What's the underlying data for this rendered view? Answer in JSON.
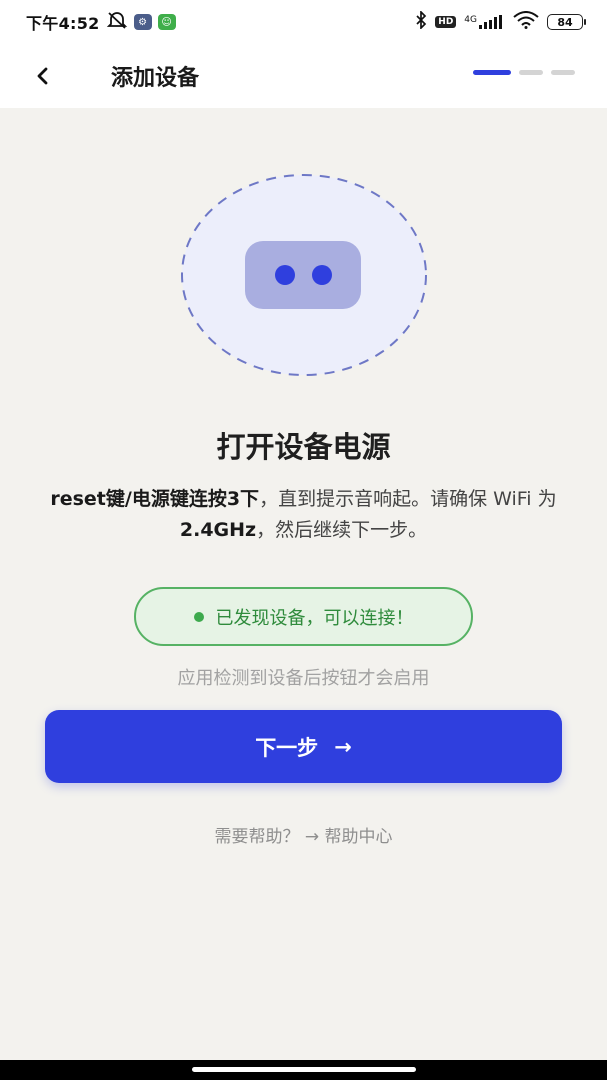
{
  "status_bar": {
    "time": "下午4:52",
    "network": "4G",
    "battery": "84",
    "hd": "HD"
  },
  "header": {
    "title": "添加设备"
  },
  "content": {
    "title": "打开设备电源",
    "desc_bold_1": "reset键/电源键连按3下",
    "desc_text_1": "，直到提示音响起。请确保 WiFi 为 ",
    "desc_bold_2": "2.4GHz",
    "desc_text_2": "，然后继续下一步。",
    "status_text": "已发现设备，可以连接！",
    "hint": "应用检测到设备后按钮才会启用",
    "next_label": "下一步",
    "next_arrow": "→",
    "help_prefix": "需要帮助？",
    "help_link": "→ 帮助中心"
  },
  "colors": {
    "accent": "#2f3fde",
    "success": "#56b264",
    "background": "#f3f2ee"
  },
  "steps": {
    "total": 3,
    "current": 1
  }
}
